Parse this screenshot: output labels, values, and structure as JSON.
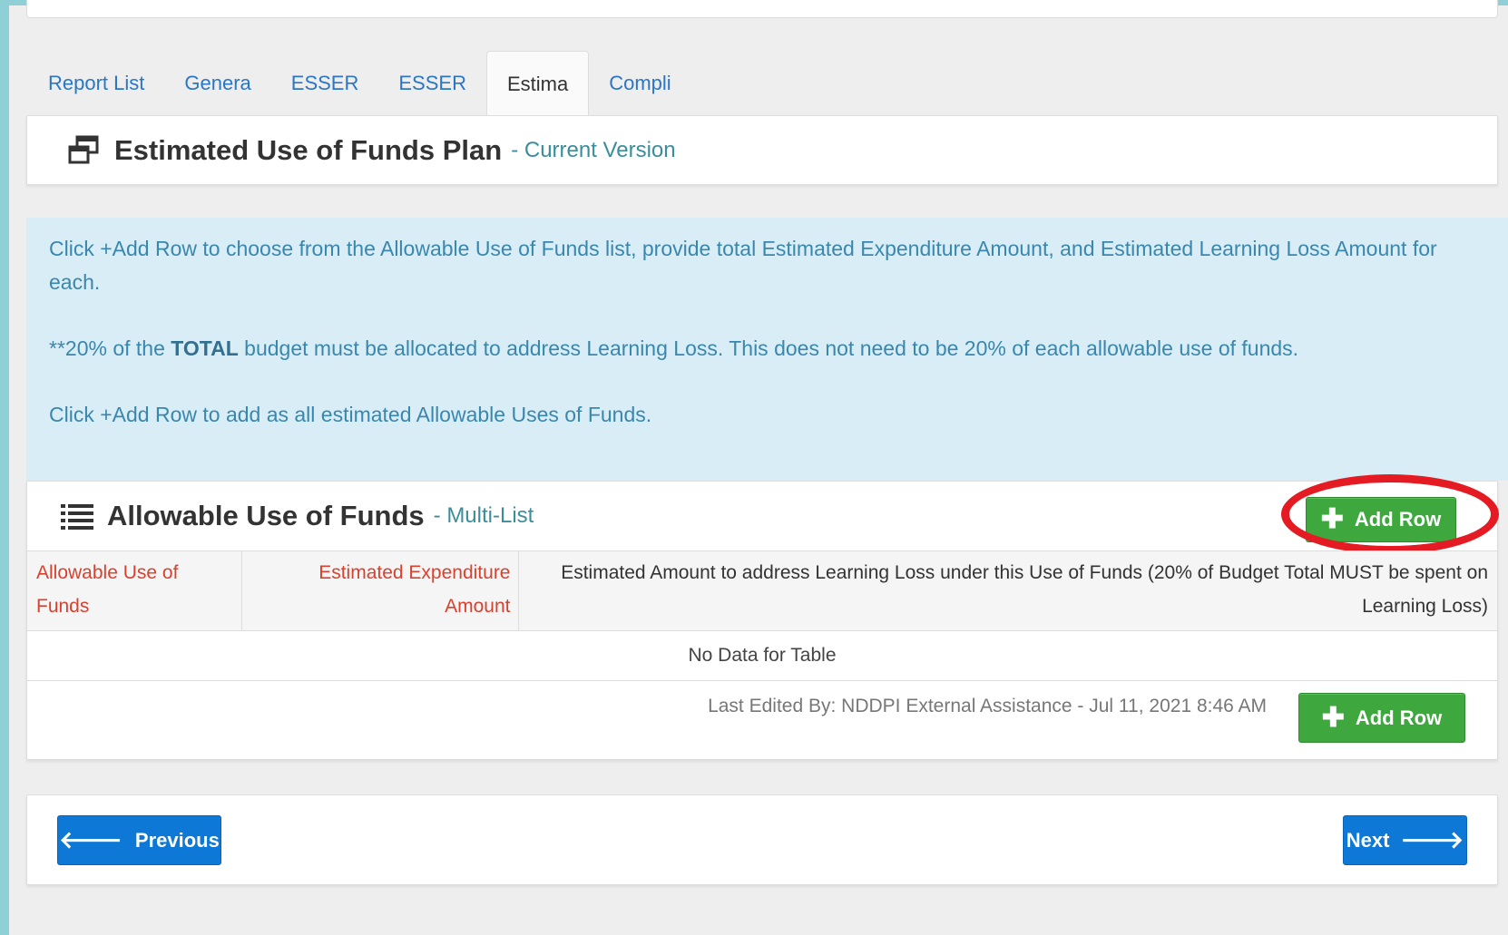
{
  "tabs": [
    {
      "label": "Report List"
    },
    {
      "label": "Genera"
    },
    {
      "label": "ESSER"
    },
    {
      "label": "ESSER"
    },
    {
      "label": "Estima"
    },
    {
      "label": "Compli"
    }
  ],
  "plan": {
    "title": "Estimated Use of Funds Plan",
    "subtitle": "- Current Version",
    "icon": "window-restore-icon"
  },
  "info": {
    "p1": "Click +Add Row to choose from the Allowable Use of Funds list, provide total Estimated Expenditure Amount, and Estimated Learning Loss Amount for each.",
    "p2_before": "**20% of the ",
    "p2_bold": "TOTAL",
    "p2_after": " budget must be allocated to address Learning Loss. This does not need to be 20% of each allowable use of funds.",
    "p3": "Click +Add Row to add as all estimated Allowable Uses of Funds."
  },
  "funds": {
    "title": "Allowable Use of Funds",
    "subtitle": "- Multi-List",
    "icon": "list-icon",
    "add_row_label": "Add Row",
    "columns": [
      "Allowable Use of Funds",
      "Estimated Expenditure Amount",
      "Estimated Amount to address Learning Loss under this Use of Funds (20% of Budget Total MUST be spent on Learning Loss)"
    ],
    "empty_text": "No Data for Table",
    "last_edited": "Last Edited By: NDDPI External Assistance - Jul 11, 2021 8:46 AM",
    "add_row_bottom_label": "Add Row"
  },
  "nav": {
    "previous_label": "Previous",
    "next_label": "Next"
  },
  "colors": {
    "tab_link": "#2a76c6",
    "info_bg": "#d9edf7",
    "info_text": "#3a87ad",
    "required_header": "#d9412f",
    "green_button": "#3ea83e",
    "blue_button": "#0d78d6",
    "highlight_ring": "#e41b23"
  }
}
